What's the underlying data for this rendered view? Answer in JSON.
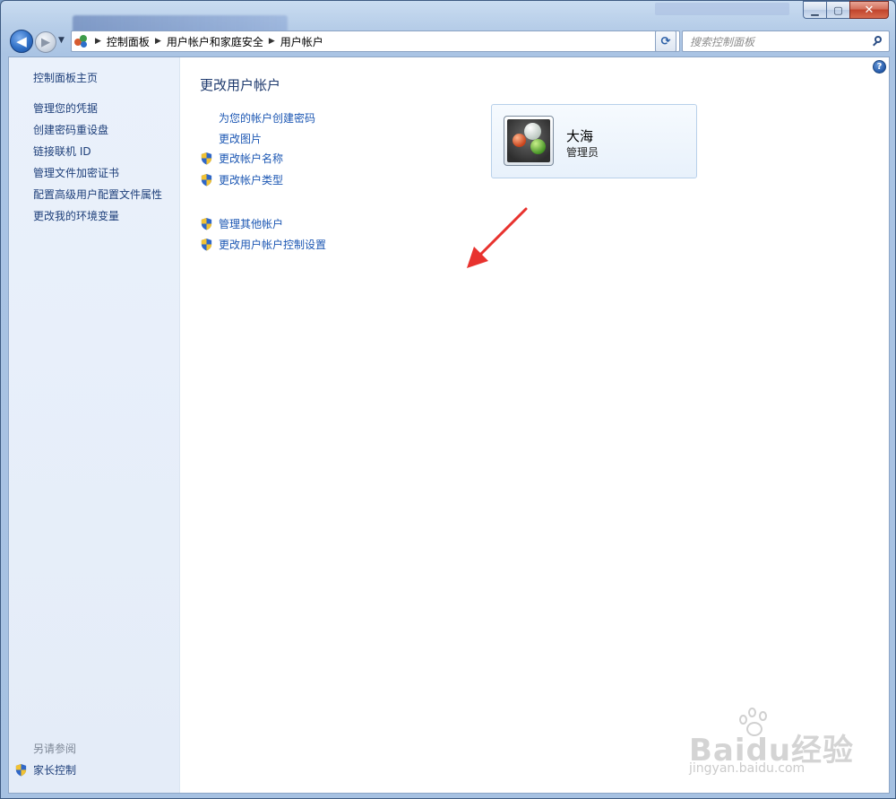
{
  "window": {
    "minimize_label": "▁",
    "maximize_label": "▢",
    "close_label": "✕"
  },
  "nav": {
    "breadcrumbs": [
      "控制面板",
      "用户帐户和家庭安全",
      "用户帐户"
    ],
    "search_placeholder": "搜索控制面板"
  },
  "sidebar": {
    "home": "控制面板主页",
    "items": [
      "管理您的凭据",
      "创建密码重设盘",
      "链接联机 ID",
      "管理文件加密证书",
      "配置高级用户配置文件属性",
      "更改我的环境变量"
    ],
    "see_also_label": "另请参阅",
    "see_also_items": [
      "家长控制"
    ]
  },
  "main": {
    "title": "更改用户帐户",
    "tasks": [
      {
        "label": "为您的帐户创建密码",
        "shield": false
      },
      {
        "label": "更改图片",
        "shield": false
      },
      {
        "label": "更改帐户名称",
        "shield": true
      },
      {
        "label": "更改帐户类型",
        "shield": true
      }
    ],
    "other_tasks": [
      {
        "label": "管理其他帐户",
        "shield": true
      },
      {
        "label": "更改用户帐户控制设置",
        "shield": true
      }
    ]
  },
  "account": {
    "name": "大海",
    "role": "管理员"
  },
  "watermark": {
    "text": "Baidu经验",
    "url": "jingyan.baidu.com"
  },
  "colors": {
    "link": "#1c57b3",
    "sidebar_link": "#1e3f7a",
    "arrow": "#e8322e"
  }
}
